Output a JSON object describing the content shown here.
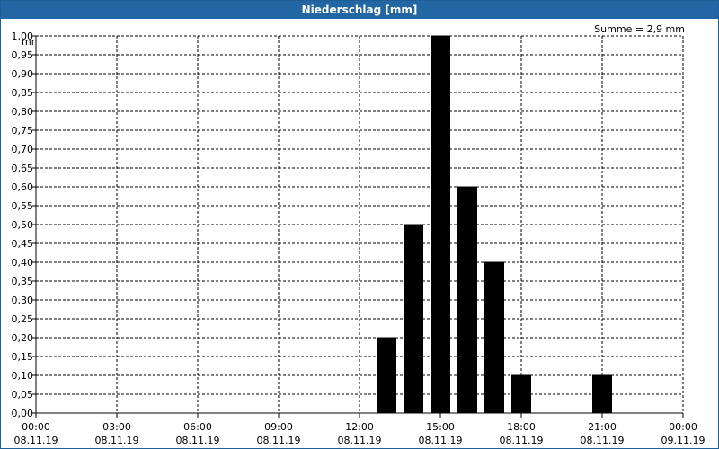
{
  "window": {
    "title": "Niederschlag [mm]"
  },
  "summary": "Summe = 2,9 mm",
  "colors": {
    "titlebar": "#2366a4",
    "bar": "#000000",
    "grid": "#000000"
  },
  "chart_data": {
    "type": "bar",
    "title": "Niederschlag [mm]",
    "ylabel": "mm",
    "ylim": [
      0,
      1.0
    ],
    "grid": true,
    "y_ticks": [
      "0,00",
      "0,05",
      "0,10",
      "0,15",
      "0,20",
      "0,25",
      "0,30",
      "0,35",
      "0,40",
      "0,45",
      "0,50",
      "0,55",
      "0,60",
      "0,65",
      "0,70",
      "0,75",
      "0,80",
      "0,85",
      "0,90",
      "0,95",
      "1,00"
    ],
    "x_ticks": [
      {
        "time": "00:00",
        "date": "08.11.19"
      },
      {
        "time": "03:00",
        "date": "08.11.19"
      },
      {
        "time": "06:00",
        "date": "08.11.19"
      },
      {
        "time": "09:00",
        "date": "08.11.19"
      },
      {
        "time": "12:00",
        "date": "08.11.19"
      },
      {
        "time": "15:00",
        "date": "08.11.19"
      },
      {
        "time": "18:00",
        "date": "08.11.19"
      },
      {
        "time": "21:00",
        "date": "08.11.19"
      },
      {
        "time": "00:00",
        "date": "09.11.19"
      }
    ],
    "x_range_hours": [
      0,
      24
    ],
    "bars": [
      {
        "hour": 13,
        "value": 0.2
      },
      {
        "hour": 14,
        "value": 0.5
      },
      {
        "hour": 15,
        "value": 1.0
      },
      {
        "hour": 16,
        "value": 0.6
      },
      {
        "hour": 17,
        "value": 0.4
      },
      {
        "hour": 18,
        "value": 0.1
      },
      {
        "hour": 21,
        "value": 0.1
      }
    ],
    "total": "2,9 mm"
  }
}
